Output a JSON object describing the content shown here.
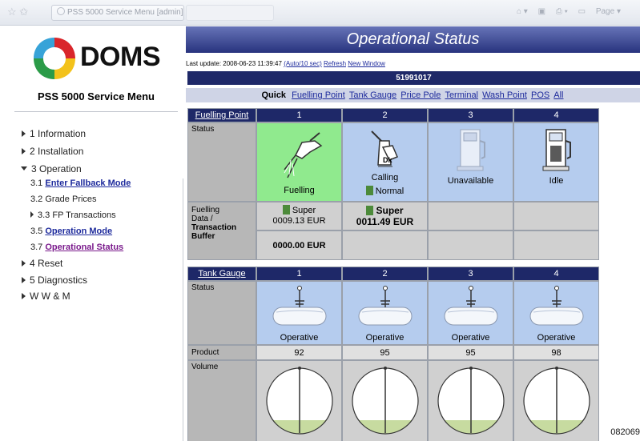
{
  "browser": {
    "tab_title": "PSS 5000 Service Menu [admin]",
    "tools": [
      "Page"
    ]
  },
  "logo": {
    "text": "DOMS"
  },
  "menu": {
    "title": "PSS 5000 Service Menu",
    "items": [
      {
        "label": "1 Information"
      },
      {
        "label": "2 Installation"
      },
      {
        "label": "3 Operation"
      },
      {
        "label": "3.1 ",
        "link": "Enter Fallback Mode"
      },
      {
        "label": "3.2 Grade Prices"
      },
      {
        "label": "3.3 FP Transactions"
      },
      {
        "label": "3.5 ",
        "link": "Operation Mode"
      },
      {
        "label": "3.7 ",
        "link": "Operational Status"
      },
      {
        "label": "4 Reset"
      },
      {
        "label": "5 Diagnostics"
      },
      {
        "label": "W W & M"
      }
    ]
  },
  "page": {
    "title": "Operational Status",
    "last_update": "Last update: 2008-06-23 11:39:47",
    "auto_link": "(Auto/10 sec)",
    "refresh_link": "Refresh",
    "new_window_link": "New Window",
    "id": "51991017",
    "quick_label": "Quick",
    "quick_links": [
      "Fuelling Point",
      "Tank Gauge",
      "Price Pole",
      "Terminal",
      "Wash Point",
      "POS",
      "All"
    ]
  },
  "fuelling": {
    "header": "Fuelling Point",
    "cols": [
      "1",
      "2",
      "3",
      "4"
    ],
    "status_label": "Status",
    "statuses": [
      "Fuelling",
      "Calling",
      "Unavailable",
      "Idle"
    ],
    "status_sub_2": "Normal",
    "data_label_1": "Fuelling",
    "data_label_2": "Data /",
    "data_label_3": "Transaction",
    "data_label_4": "Buffer",
    "fp1_grade": "Super",
    "fp1_amount": "0009.13 EUR",
    "fp1_buffer": "0000.00 EUR",
    "fp2_grade": "Super",
    "fp2_amount": "0011.49 EUR"
  },
  "tank": {
    "header": "Tank Gauge",
    "cols": [
      "1",
      "2",
      "3",
      "4"
    ],
    "status_label": "Status",
    "statuses": [
      "Operative",
      "Operative",
      "Operative",
      "Operative"
    ],
    "product_label": "Product",
    "products": [
      "92",
      "95",
      "95",
      "98"
    ],
    "volume_label": "Volume"
  },
  "doc_id": "082069",
  "colors": {
    "title_bar": "#28337e",
    "header": "#1e2868",
    "blue_cell": "#b5ccee",
    "green_cell": "#90ea8e",
    "label_cell": "#b7b7b7"
  }
}
